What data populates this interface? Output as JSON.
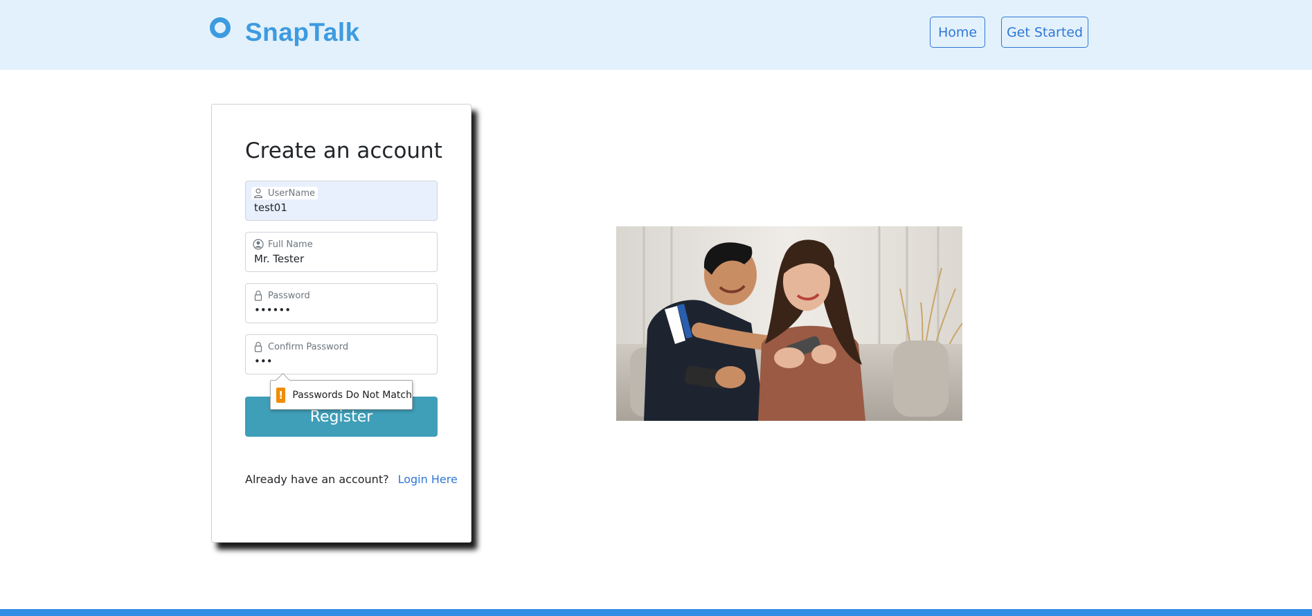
{
  "brand": {
    "name": "SnapTalk"
  },
  "nav": {
    "home": "Home",
    "get_started": "Get Started"
  },
  "form": {
    "title": "Create an account",
    "fields": [
      {
        "label": "UserName",
        "value": "test01",
        "icon": "user-icon",
        "type": "text"
      },
      {
        "label": "Full Name",
        "value": "Mr. Tester",
        "icon": "user-circle-icon",
        "type": "text"
      },
      {
        "label": "Password",
        "value": "••••••",
        "icon": "lock-icon",
        "type": "password"
      },
      {
        "label": "Confirm Password",
        "value": "•••",
        "icon": "lock-icon",
        "type": "password"
      }
    ],
    "register_label": "Register",
    "validation_message": "Passwords Do Not Match",
    "account_question": "Already have an account?",
    "login_link": "Login Here"
  },
  "colors": {
    "brand": "#3d9be0",
    "header_bg": "#e3f1fc",
    "register_button": "#3f9eb8",
    "link": "#2f77d6",
    "warning": "#f08c00",
    "bottom_bar": "#2f8de4"
  },
  "hero_image": {
    "icon": "couple-playing-mobile-game-photo"
  }
}
